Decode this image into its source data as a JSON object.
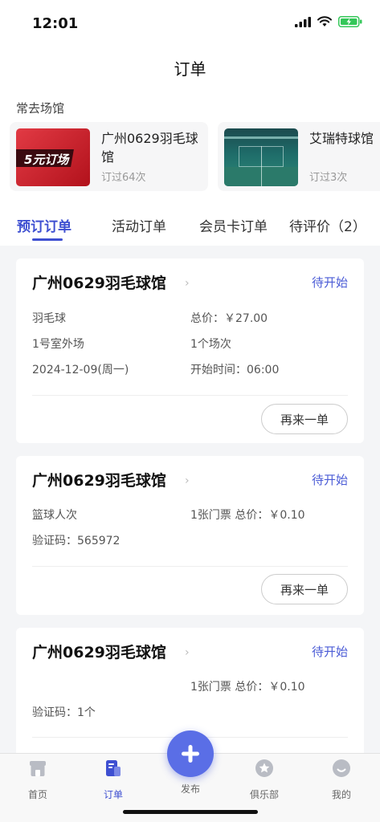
{
  "status_bar": {
    "time": "12:01"
  },
  "header": {
    "title": "订单"
  },
  "frequent": {
    "label": "常去场馆",
    "venues": [
      {
        "name": "广州0629羽毛球馆",
        "count": "订过64次",
        "thumb_text": "5元订场"
      },
      {
        "name": "艾瑞特球馆",
        "count": "订过3次"
      }
    ]
  },
  "tabs": [
    {
      "label": "预订订单",
      "active": true
    },
    {
      "label": "活动订单"
    },
    {
      "label": "会员卡订单"
    },
    {
      "label": "待评价（2）"
    }
  ],
  "orders": [
    {
      "venue": "广州0629羽毛球馆",
      "chevron": "›",
      "status": "待开始",
      "left": [
        "羽毛球",
        "1号室外场",
        "2024-12-09(周一)"
      ],
      "right": [
        "总价：￥27.00",
        "1个场次",
        "开始时间：06:00"
      ],
      "button": "再来一单"
    },
    {
      "venue": "广州0629羽毛球馆",
      "chevron": "›",
      "status": "待开始",
      "left": [
        "篮球人次",
        "验证码：565972"
      ],
      "right": [
        "1张门票 总价：￥0.10"
      ],
      "button": "再来一单"
    },
    {
      "venue": "广州0629羽毛球馆",
      "chevron": "›",
      "status": "待开始",
      "right": [
        "1张门票 总价：￥0.10"
      ],
      "left_lower": "验证码：1个"
    }
  ],
  "tabbar": {
    "items": [
      {
        "label": "首页",
        "icon": "home-icon"
      },
      {
        "label": "订单",
        "icon": "order-icon",
        "active": true
      },
      {
        "label": "发布",
        "icon": "plus-icon"
      },
      {
        "label": "俱乐部",
        "icon": "club-icon"
      },
      {
        "label": "我的",
        "icon": "profile-icon"
      }
    ]
  },
  "colors": {
    "accent": "#3e4fd1",
    "status": "#4a5bd6",
    "fab": "#5a6ee6"
  }
}
